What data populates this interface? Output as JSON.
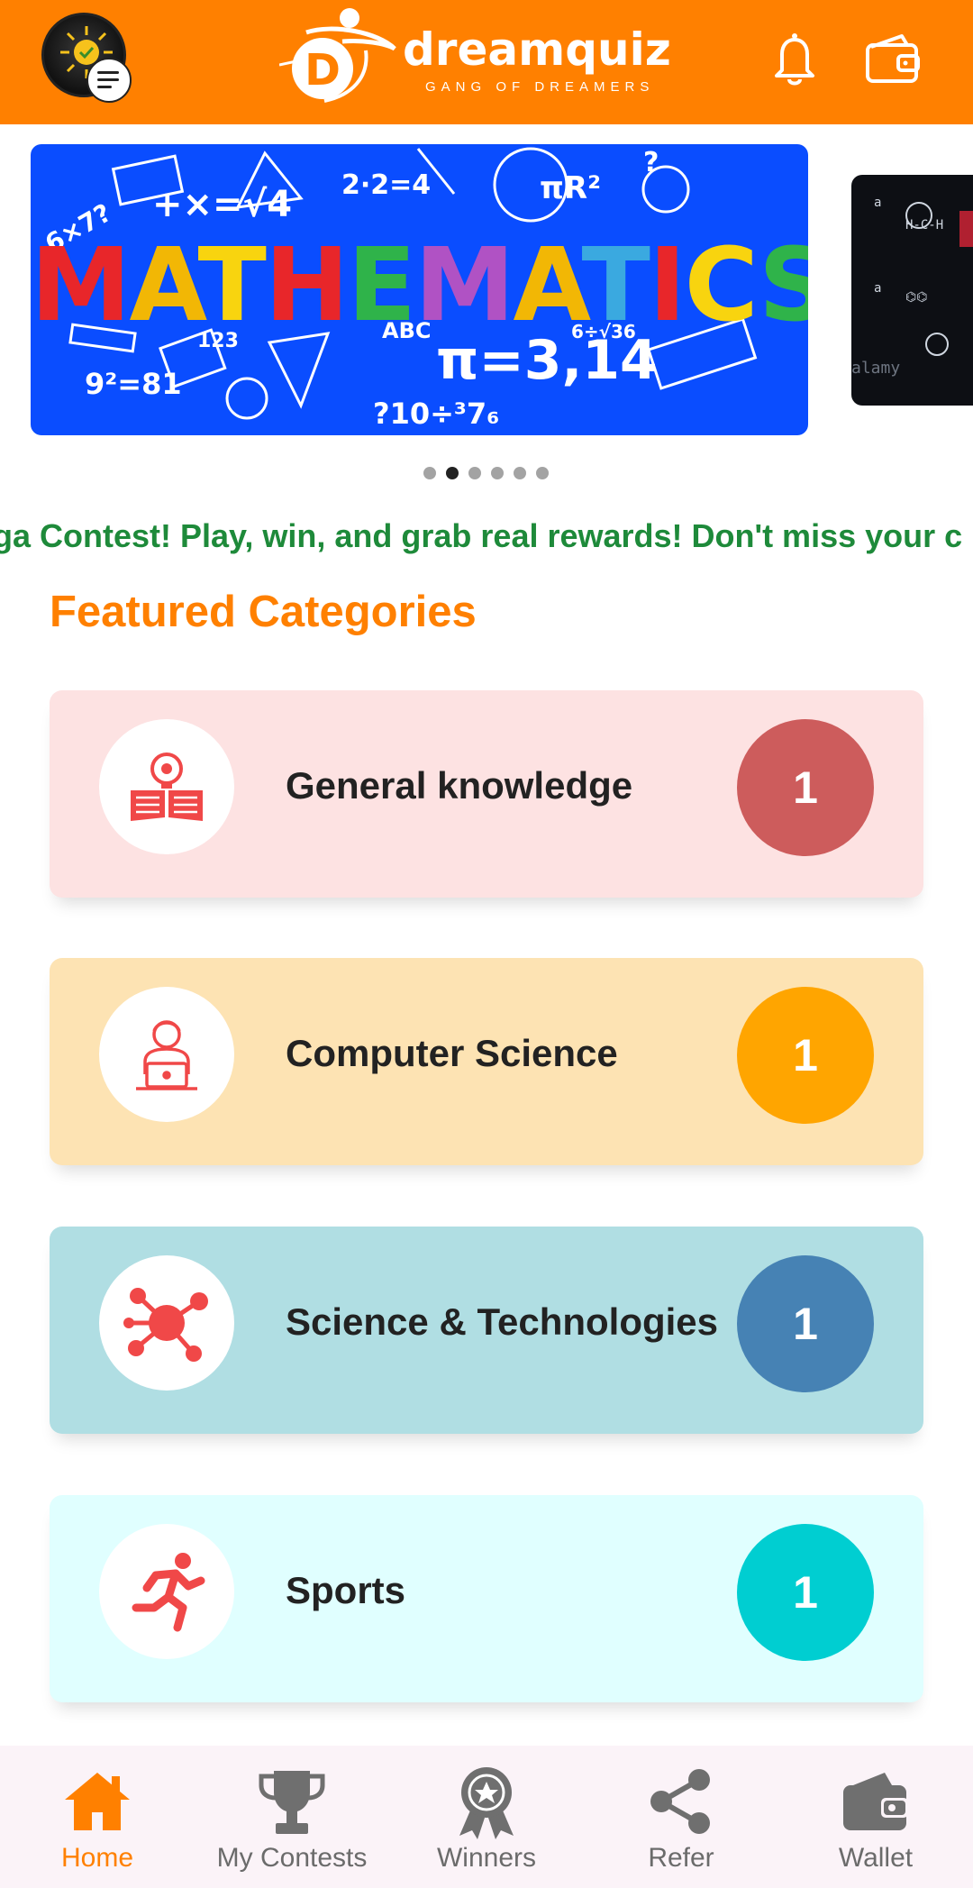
{
  "header": {
    "logo_text": "dreamquiz",
    "logo_tagline": "GANG OF DREAMERS",
    "logo_letter": "D"
  },
  "carousel": {
    "slide_title": "MATHEMATICS",
    "slide_count": 6,
    "active_index": 1
  },
  "announcement": "ga Contest! Play, win, and grab real rewards! Don't miss your c",
  "featured_title": "Featured Categories",
  "categories": [
    {
      "label": "General knowledge",
      "count": "1",
      "icon": "book-lightbulb-icon",
      "bg": "#fde2e2",
      "accent": "#cd5c5c"
    },
    {
      "label": "Computer Science",
      "count": "1",
      "icon": "laptop-user-icon",
      "bg": "#fde3b3",
      "accent": "#ffa500"
    },
    {
      "label": "Science & Technologies",
      "count": "1",
      "icon": "molecule-icon",
      "bg": "#b0dee3",
      "accent": "#4682b4"
    },
    {
      "label": "Sports",
      "count": "1",
      "icon": "running-person-icon",
      "bg": "#e0ffff",
      "accent": "#00ced1"
    }
  ],
  "bottom_nav": [
    {
      "label": "Home",
      "icon": "home-icon",
      "active": true
    },
    {
      "label": "My Contests",
      "icon": "trophy-icon",
      "active": false
    },
    {
      "label": "Winners",
      "icon": "award-badge-icon",
      "active": false
    },
    {
      "label": "Refer",
      "icon": "share-icon",
      "active": false
    },
    {
      "label": "Wallet",
      "icon": "wallet-icon",
      "active": false
    }
  ],
  "colors": {
    "brand": "#ff8000",
    "marquee": "#1e8a3a",
    "icon_red": "#f04848"
  }
}
